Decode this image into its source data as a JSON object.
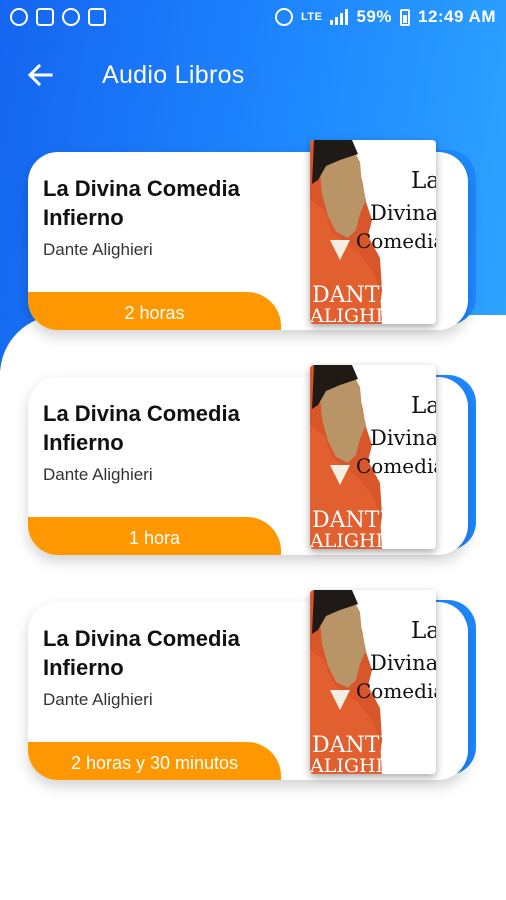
{
  "status_bar": {
    "battery": "59%",
    "time": "12:49 AM",
    "network": "LTE"
  },
  "app_bar": {
    "title": "Audio Libros",
    "back_icon": "arrow-back-icon"
  },
  "colors": {
    "primary": "#1e88ff",
    "accent": "#ff9800"
  },
  "books": [
    {
      "title_line1": "La Divina Comedia",
      "title_line2": "Infierno",
      "author": "Dante Alighieri",
      "duration": "2 horas",
      "cover": {
        "line1": "La",
        "line2": "Divina",
        "line3": "Comedia",
        "name1": "DANTE",
        "name2": "ALIGHIERI"
      }
    },
    {
      "title_line1": "La Divina Comedia",
      "title_line2": "Infierno",
      "author": "Dante Alighieri",
      "duration": "1 hora",
      "cover": {
        "line1": "La",
        "line2": "Divina",
        "line3": "Comedia",
        "name1": "DANTE",
        "name2": "ALIGHIERI"
      }
    },
    {
      "title_line1": "La Divina Comedia",
      "title_line2": "Infierno",
      "author": "Dante Alighieri",
      "duration": "2 horas y 30 minutos",
      "cover": {
        "line1": "La",
        "line2": "Divina",
        "line3": "Comedia",
        "name1": "DANTE",
        "name2": "ALIGHIERI"
      }
    }
  ]
}
